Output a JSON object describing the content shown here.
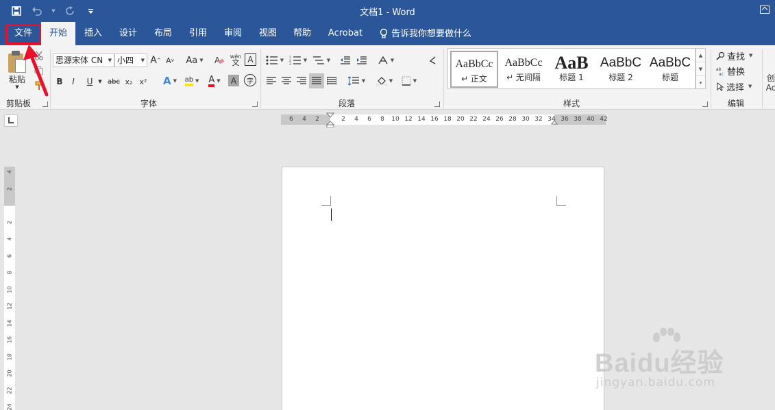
{
  "title_bar": {
    "document_title": "文档1  -  Word",
    "qat": [
      {
        "name": "save-icon",
        "glyph": "🖫"
      },
      {
        "name": "undo-icon",
        "glyph": "↶"
      },
      {
        "name": "redo-icon",
        "glyph": "↻"
      },
      {
        "name": "customize-qat-icon",
        "glyph": "⌄"
      }
    ]
  },
  "tabs": [
    "文件",
    "开始",
    "插入",
    "设计",
    "布局",
    "引用",
    "审阅",
    "视图",
    "帮助",
    "Acrobat"
  ],
  "active_tab": "开始",
  "tell_me": "告诉我你想要做什么",
  "ribbon": {
    "clipboard": {
      "label": "剪贴板",
      "paste": "粘贴"
    },
    "font": {
      "label": "字体",
      "font_name": "思源宋体 CN",
      "font_size": "小四",
      "grow": "A",
      "shrink": "A",
      "case": "Aa",
      "phonetic": "wén",
      "border_char": "A",
      "bold": "B",
      "italic": "I",
      "underline": "U",
      "strike": "abc",
      "sub": "x₂",
      "sup": "x²",
      "effects": "A",
      "highlight": "ab",
      "font_color": "A",
      "char_shading": "A",
      "enclose": "字"
    },
    "paragraph": {
      "label": "段落"
    },
    "styles": {
      "label": "样式",
      "items": [
        {
          "sample": "AaBbCc",
          "name": "↵ 正文"
        },
        {
          "sample": "AaBbCc",
          "name": "↵ 无间隔"
        },
        {
          "sample": "AaB",
          "name": "标题 1"
        },
        {
          "sample": "AaBbC",
          "name": "标题 2"
        },
        {
          "sample": "AaBbC",
          "name": "标题"
        }
      ]
    },
    "editing": {
      "label": "编辑",
      "find": "查找",
      "replace": "替换",
      "select": "选择"
    },
    "cut_off": {
      "line1": "创",
      "line2": "Ac"
    }
  },
  "ruler": {
    "horizontal_ticks": [
      "6",
      "4",
      "2",
      "2",
      "4",
      "6",
      "8",
      "10",
      "12",
      "14",
      "16",
      "18",
      "20",
      "22",
      "24",
      "26",
      "28",
      "30",
      "32",
      "34",
      "36",
      "38",
      "40",
      "42"
    ],
    "vertical_ticks": [
      "4",
      "2",
      "2",
      "4",
      "6",
      "8",
      "10",
      "12",
      "14",
      "16",
      "18",
      "20",
      "22",
      "24"
    ]
  },
  "watermark": {
    "main": "Baidu经验",
    "sub": "jingyan.baidu.com"
  },
  "colors": {
    "accent": "#2b579a",
    "highlight_box": "#e8102a",
    "font_color_bar": "#e81123",
    "highlight_bar": "#f7e30b"
  }
}
